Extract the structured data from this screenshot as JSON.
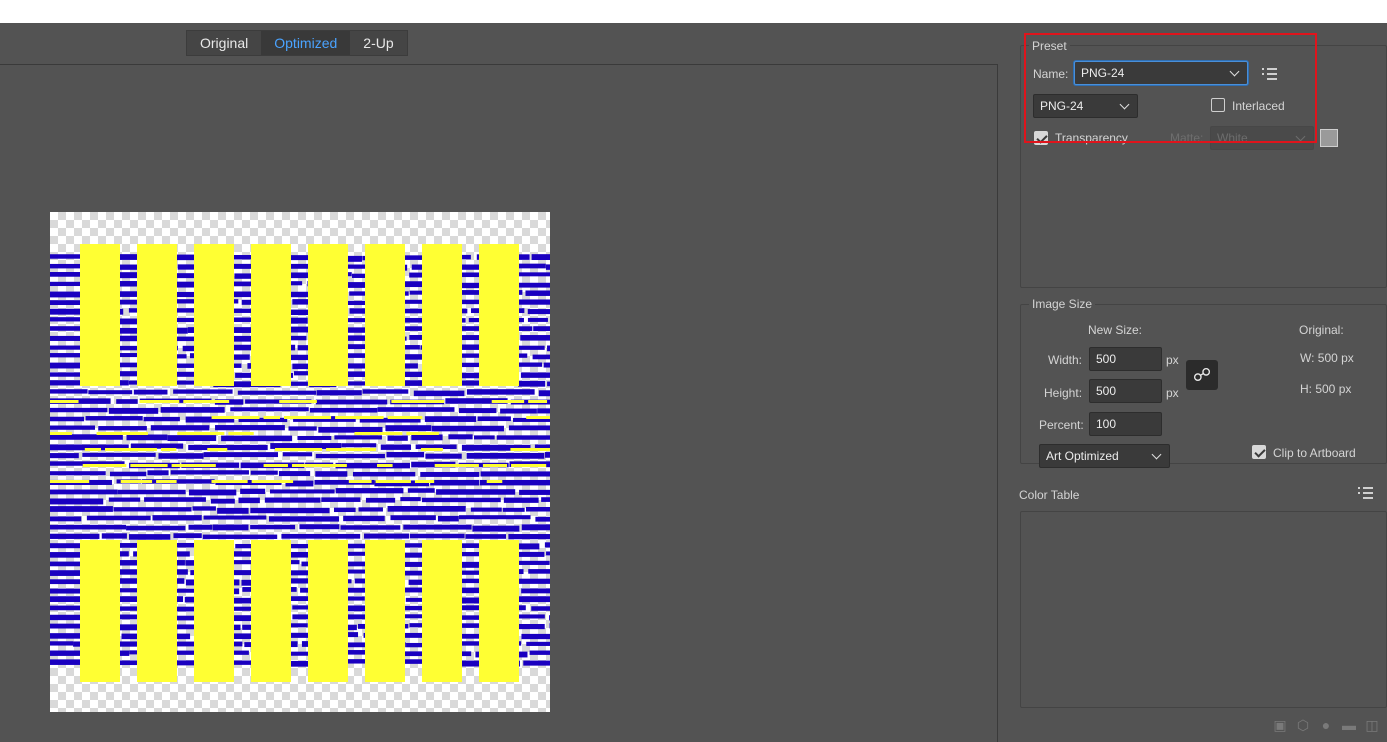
{
  "view_tabs": [
    {
      "label": "Original",
      "active": false
    },
    {
      "label": "Optimized",
      "active": true
    },
    {
      "label": "2-Up",
      "active": false
    }
  ],
  "preset": {
    "title": "Preset",
    "name_label": "Name:",
    "name_value": "PNG-24",
    "format_value": "PNG-24",
    "interlaced_label": "Interlaced",
    "interlaced_checked": false,
    "transparency_label": "Transparency",
    "transparency_checked": true,
    "matte_label": "Matte:",
    "matte_value": "White",
    "menu_icon": "list-menu-icon"
  },
  "image_size": {
    "title": "Image Size",
    "new_size_label": "New Size:",
    "original_label": "Original:",
    "width_label": "Width:",
    "width_value": "500",
    "width_unit": "px",
    "height_label": "Height:",
    "height_value": "500",
    "height_unit": "px",
    "percent_label": "Percent:",
    "percent_value": "100",
    "original_w": "W:  500 px",
    "original_h": "H:  500 px",
    "resample_value": "Art Optimized",
    "clip_label": "Clip to Artboard",
    "clip_checked": true,
    "link_icon": "chain-link-icon"
  },
  "color_table": {
    "title": "Color Table",
    "menu_icon": "list-menu-icon"
  },
  "footer_icons": [
    "web-shift-icon",
    "cube-icon",
    "lock-icon",
    "new-color-icon",
    "trash-icon"
  ],
  "colors": {
    "panel_bg": "#535353",
    "accent": "#4aa3ff",
    "highlight": "#e0141c",
    "art_yellow": "#ffff33",
    "art_blue": "#1a00c0"
  }
}
